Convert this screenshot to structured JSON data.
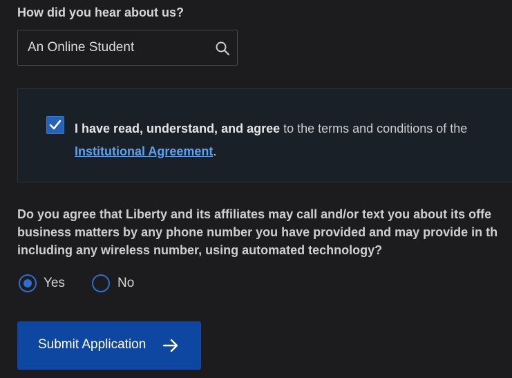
{
  "referral": {
    "question": "How did you hear about us?",
    "value": "An Online Student",
    "icon": "search-icon"
  },
  "agreement": {
    "checked": true,
    "bold_text": "I have read, understand, and agree",
    "text": " to the terms and conditions of the",
    "link_text": "Institutional Agreement",
    "suffix": "."
  },
  "consent": {
    "question_lines": [
      "Do you agree that Liberty and its affiliates may call and/or text you about its offe",
      "business matters by any phone number you have provided and may provide in th",
      "including any wireless number, using automated technology?"
    ],
    "options": [
      {
        "label": "Yes",
        "selected": true
      },
      {
        "label": "No",
        "selected": false
      }
    ]
  },
  "submit": {
    "label": "Submit Application",
    "icon": "arrow-right-icon"
  },
  "colors": {
    "background": "#1c1c1e",
    "panel": "#1a2028",
    "accent": "#2f6fcb",
    "button": "#0d47a1",
    "link": "#5aa2f0"
  }
}
